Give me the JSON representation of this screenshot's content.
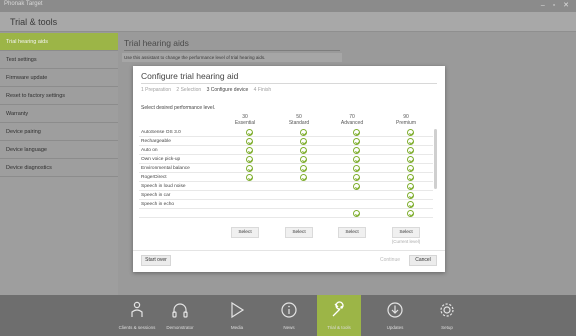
{
  "window": {
    "app_name": "Phonak Target",
    "controls": "‒ ▫ ✕"
  },
  "section": {
    "title": "Trial & tools"
  },
  "sidebar": {
    "items": [
      {
        "label": "Trial hearing aids",
        "active": true
      },
      {
        "label": "Test settings",
        "active": false
      },
      {
        "label": "Firmware update",
        "active": false
      },
      {
        "label": "Reset to factory settings",
        "active": false
      },
      {
        "label": "Warranty",
        "active": false
      },
      {
        "label": "Device pairing",
        "active": false
      },
      {
        "label": "Device language",
        "active": false
      },
      {
        "label": "Device diagnostics",
        "active": false
      }
    ]
  },
  "main": {
    "title": "Trial hearing aids",
    "description": "Use this assistant to change the performance level of trial hearing aids."
  },
  "dialog": {
    "title": "Configure trial hearing aid",
    "steps": [
      {
        "label": "1 Preparation",
        "current": false
      },
      {
        "label": "2 Selection",
        "current": false
      },
      {
        "label": "3 Configure device",
        "current": true
      },
      {
        "label": "4 Finish",
        "current": false
      }
    ],
    "instruction": "Select desired performance level.",
    "levels": [
      {
        "number": "30",
        "name": "Essential"
      },
      {
        "number": "50",
        "name": "Standard"
      },
      {
        "number": "70",
        "name": "Advanced"
      },
      {
        "number": "90",
        "name": "Premium"
      }
    ],
    "features": [
      {
        "name": "AutoSense OS 3.0",
        "checks": [
          true,
          true,
          true,
          true
        ]
      },
      {
        "name": "Rechargeable",
        "checks": [
          true,
          true,
          true,
          true
        ]
      },
      {
        "name": "Auto on",
        "checks": [
          true,
          true,
          true,
          true
        ]
      },
      {
        "name": "Own voice pick-up",
        "checks": [
          true,
          true,
          true,
          true
        ]
      },
      {
        "name": "Environmental balance",
        "checks": [
          true,
          true,
          true,
          true
        ]
      },
      {
        "name": "RogerDirect",
        "checks": [
          true,
          true,
          true,
          true
        ]
      },
      {
        "name": "Speech in loud noise",
        "checks": [
          false,
          false,
          true,
          true
        ]
      },
      {
        "name": "Speech in car",
        "checks": [
          false,
          false,
          false,
          true
        ]
      },
      {
        "name": "Speech in echo",
        "checks": [
          false,
          false,
          false,
          true
        ]
      },
      {
        "name": "",
        "checks": [
          false,
          false,
          true,
          true
        ]
      }
    ],
    "select_label": "Select",
    "current_level_note": "(Current level)",
    "start_over": "Start over",
    "continue": "Continue",
    "cancel": "Cancel"
  },
  "bottom_nav": [
    {
      "label": "Clients & sessions",
      "icon": "person-icon",
      "active": false
    },
    {
      "label": "Demonstrator",
      "icon": "headphones-icon",
      "active": false
    },
    {
      "label": "Media",
      "icon": "play-icon",
      "active": false
    },
    {
      "label": "News",
      "icon": "info-icon",
      "active": false
    },
    {
      "label": "Trial & tools",
      "icon": "wrench-icon",
      "active": true
    },
    {
      "label": "Updates",
      "icon": "download-icon",
      "active": false
    },
    {
      "label": "Setup",
      "icon": "gear-icon",
      "active": false
    }
  ],
  "colors": {
    "accent": "#9cb547",
    "check": "#7fae2e"
  }
}
